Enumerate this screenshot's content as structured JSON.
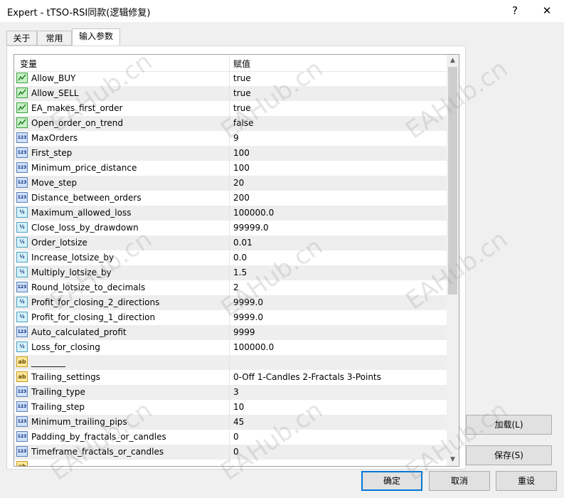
{
  "window": {
    "title": "Expert - tTSO-RSI同款(逻辑修复)",
    "help_label": "?",
    "close_label": "✕"
  },
  "tabs": [
    {
      "label": "关于"
    },
    {
      "label": "常用"
    },
    {
      "label": "输入参数"
    }
  ],
  "grid": {
    "header": {
      "variable": "变量",
      "value": "赋值"
    },
    "rows": [
      {
        "type": "bool",
        "name": "Allow_BUY",
        "value": "true"
      },
      {
        "type": "bool",
        "name": "Allow_SELL",
        "value": "true"
      },
      {
        "type": "bool",
        "name": "EA_makes_first_order",
        "value": "true"
      },
      {
        "type": "bool",
        "name": "Open_order_on_trend",
        "value": "false"
      },
      {
        "type": "int",
        "name": "MaxOrders",
        "value": "9"
      },
      {
        "type": "int",
        "name": "First_step",
        "value": "100"
      },
      {
        "type": "int",
        "name": "Minimum_price_distance",
        "value": "100"
      },
      {
        "type": "int",
        "name": "Move_step",
        "value": "20"
      },
      {
        "type": "int",
        "name": "Distance_between_orders",
        "value": "200"
      },
      {
        "type": "dbl",
        "name": "Maximum_allowed_loss",
        "value": "100000.0"
      },
      {
        "type": "dbl",
        "name": "Close_loss_by_drawdown",
        "value": "99999.0"
      },
      {
        "type": "dbl",
        "name": "Order_lotsize",
        "value": "0.01"
      },
      {
        "type": "dbl",
        "name": "Increase_lotsize_by",
        "value": "0.0"
      },
      {
        "type": "dbl",
        "name": "Multiply_lotsize_by",
        "value": "1.5"
      },
      {
        "type": "int",
        "name": "Round_lotsize_to_decimals",
        "value": "2"
      },
      {
        "type": "dbl",
        "name": "Profit_for_closing_2_directions",
        "value": "9999.0"
      },
      {
        "type": "dbl",
        "name": "Profit_for_closing_1_direction",
        "value": "9999.0"
      },
      {
        "type": "int",
        "name": "Auto_calculated_profit",
        "value": "9999"
      },
      {
        "type": "dbl",
        "name": "Loss_for_closing",
        "value": "100000.0"
      },
      {
        "type": "str",
        "name": "________",
        "value": ""
      },
      {
        "type": "str",
        "name": "Trailing_settings",
        "value": "0-Off  1-Candles  2-Fractals  3-Points"
      },
      {
        "type": "int",
        "name": "Trailing_type",
        "value": "3"
      },
      {
        "type": "int",
        "name": "Trailing_step",
        "value": "10"
      },
      {
        "type": "int",
        "name": "Minimum_trailing_pips",
        "value": "45"
      },
      {
        "type": "int",
        "name": "Padding_by_fractals_or_candles",
        "value": "0"
      },
      {
        "type": "int",
        "name": "Timeframe_fractals_or_candles",
        "value": "0"
      },
      {
        "type": "str",
        "name": "",
        "value": ""
      }
    ]
  },
  "side_buttons": {
    "load": "加载(L)",
    "save": "保存(S)"
  },
  "footer_buttons": {
    "ok": "确定",
    "cancel": "取消",
    "reset": "重设"
  },
  "watermark": "EAHub.cn",
  "icon_labels": {
    "int": "123",
    "dbl": "½",
    "str": "ab"
  }
}
